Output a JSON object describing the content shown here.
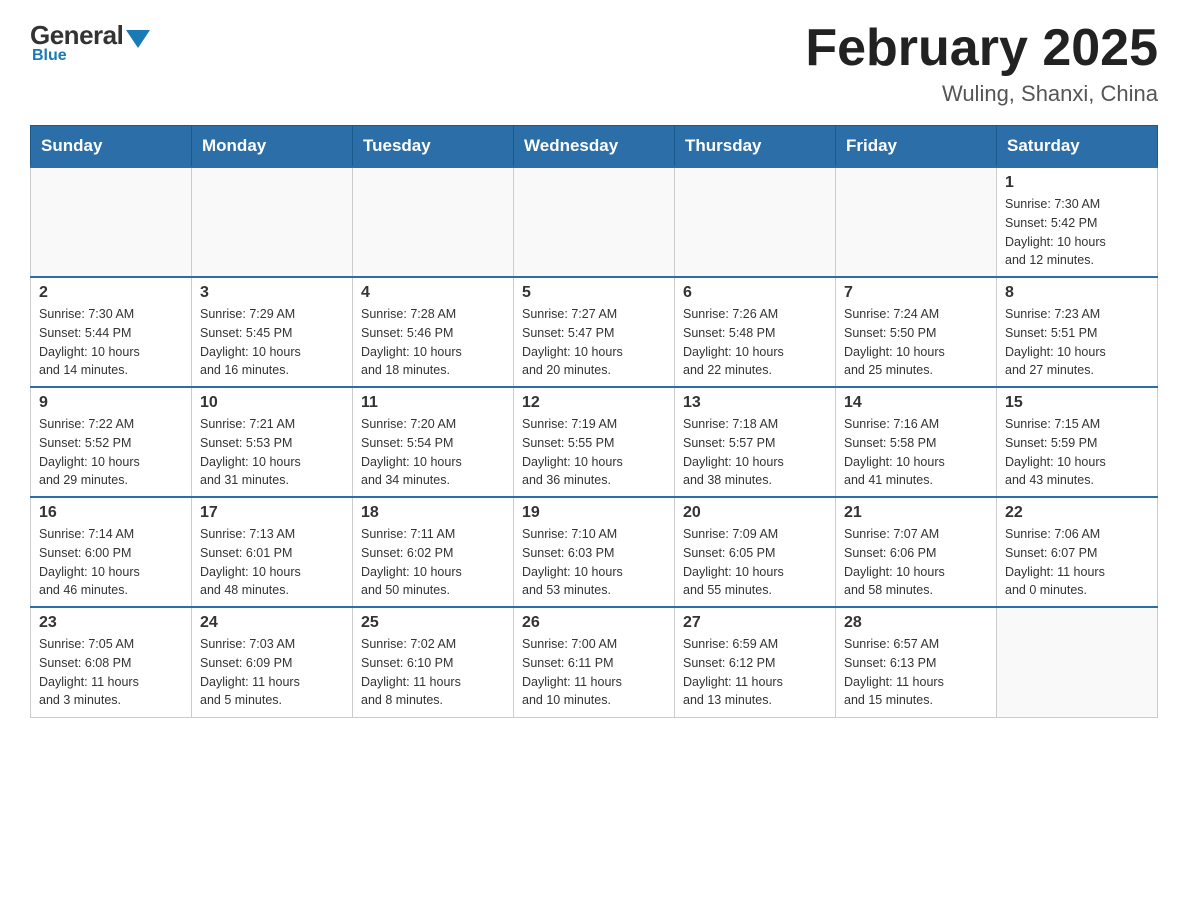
{
  "header": {
    "logo": {
      "general": "General",
      "blue": "Blue"
    },
    "title": "February 2025",
    "location": "Wuling, Shanxi, China"
  },
  "weekdays": [
    "Sunday",
    "Monday",
    "Tuesday",
    "Wednesday",
    "Thursday",
    "Friday",
    "Saturday"
  ],
  "weeks": [
    [
      {
        "day": "",
        "info": ""
      },
      {
        "day": "",
        "info": ""
      },
      {
        "day": "",
        "info": ""
      },
      {
        "day": "",
        "info": ""
      },
      {
        "day": "",
        "info": ""
      },
      {
        "day": "",
        "info": ""
      },
      {
        "day": "1",
        "info": "Sunrise: 7:30 AM\nSunset: 5:42 PM\nDaylight: 10 hours\nand 12 minutes."
      }
    ],
    [
      {
        "day": "2",
        "info": "Sunrise: 7:30 AM\nSunset: 5:44 PM\nDaylight: 10 hours\nand 14 minutes."
      },
      {
        "day": "3",
        "info": "Sunrise: 7:29 AM\nSunset: 5:45 PM\nDaylight: 10 hours\nand 16 minutes."
      },
      {
        "day": "4",
        "info": "Sunrise: 7:28 AM\nSunset: 5:46 PM\nDaylight: 10 hours\nand 18 minutes."
      },
      {
        "day": "5",
        "info": "Sunrise: 7:27 AM\nSunset: 5:47 PM\nDaylight: 10 hours\nand 20 minutes."
      },
      {
        "day": "6",
        "info": "Sunrise: 7:26 AM\nSunset: 5:48 PM\nDaylight: 10 hours\nand 22 minutes."
      },
      {
        "day": "7",
        "info": "Sunrise: 7:24 AM\nSunset: 5:50 PM\nDaylight: 10 hours\nand 25 minutes."
      },
      {
        "day": "8",
        "info": "Sunrise: 7:23 AM\nSunset: 5:51 PM\nDaylight: 10 hours\nand 27 minutes."
      }
    ],
    [
      {
        "day": "9",
        "info": "Sunrise: 7:22 AM\nSunset: 5:52 PM\nDaylight: 10 hours\nand 29 minutes."
      },
      {
        "day": "10",
        "info": "Sunrise: 7:21 AM\nSunset: 5:53 PM\nDaylight: 10 hours\nand 31 minutes."
      },
      {
        "day": "11",
        "info": "Sunrise: 7:20 AM\nSunset: 5:54 PM\nDaylight: 10 hours\nand 34 minutes."
      },
      {
        "day": "12",
        "info": "Sunrise: 7:19 AM\nSunset: 5:55 PM\nDaylight: 10 hours\nand 36 minutes."
      },
      {
        "day": "13",
        "info": "Sunrise: 7:18 AM\nSunset: 5:57 PM\nDaylight: 10 hours\nand 38 minutes."
      },
      {
        "day": "14",
        "info": "Sunrise: 7:16 AM\nSunset: 5:58 PM\nDaylight: 10 hours\nand 41 minutes."
      },
      {
        "day": "15",
        "info": "Sunrise: 7:15 AM\nSunset: 5:59 PM\nDaylight: 10 hours\nand 43 minutes."
      }
    ],
    [
      {
        "day": "16",
        "info": "Sunrise: 7:14 AM\nSunset: 6:00 PM\nDaylight: 10 hours\nand 46 minutes."
      },
      {
        "day": "17",
        "info": "Sunrise: 7:13 AM\nSunset: 6:01 PM\nDaylight: 10 hours\nand 48 minutes."
      },
      {
        "day": "18",
        "info": "Sunrise: 7:11 AM\nSunset: 6:02 PM\nDaylight: 10 hours\nand 50 minutes."
      },
      {
        "day": "19",
        "info": "Sunrise: 7:10 AM\nSunset: 6:03 PM\nDaylight: 10 hours\nand 53 minutes."
      },
      {
        "day": "20",
        "info": "Sunrise: 7:09 AM\nSunset: 6:05 PM\nDaylight: 10 hours\nand 55 minutes."
      },
      {
        "day": "21",
        "info": "Sunrise: 7:07 AM\nSunset: 6:06 PM\nDaylight: 10 hours\nand 58 minutes."
      },
      {
        "day": "22",
        "info": "Sunrise: 7:06 AM\nSunset: 6:07 PM\nDaylight: 11 hours\nand 0 minutes."
      }
    ],
    [
      {
        "day": "23",
        "info": "Sunrise: 7:05 AM\nSunset: 6:08 PM\nDaylight: 11 hours\nand 3 minutes."
      },
      {
        "day": "24",
        "info": "Sunrise: 7:03 AM\nSunset: 6:09 PM\nDaylight: 11 hours\nand 5 minutes."
      },
      {
        "day": "25",
        "info": "Sunrise: 7:02 AM\nSunset: 6:10 PM\nDaylight: 11 hours\nand 8 minutes."
      },
      {
        "day": "26",
        "info": "Sunrise: 7:00 AM\nSunset: 6:11 PM\nDaylight: 11 hours\nand 10 minutes."
      },
      {
        "day": "27",
        "info": "Sunrise: 6:59 AM\nSunset: 6:12 PM\nDaylight: 11 hours\nand 13 minutes."
      },
      {
        "day": "28",
        "info": "Sunrise: 6:57 AM\nSunset: 6:13 PM\nDaylight: 11 hours\nand 15 minutes."
      },
      {
        "day": "",
        "info": ""
      }
    ]
  ]
}
